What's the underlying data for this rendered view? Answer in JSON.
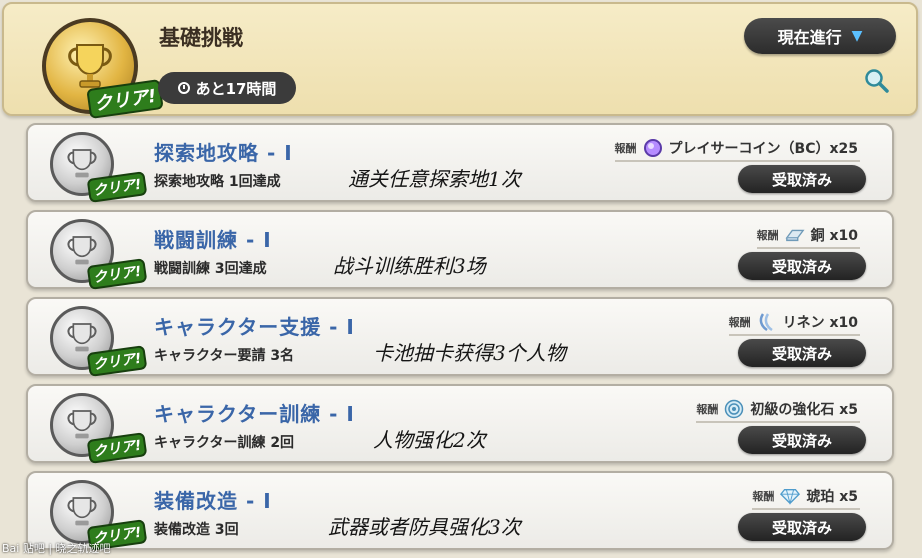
{
  "header": {
    "title": "基礎挑戦",
    "timer": "あと17時間",
    "progress_button": "現在進行",
    "clear_label": "クリア!"
  },
  "reward_label": "報酬",
  "claim_label": "受取済み",
  "missions": [
    {
      "name": "探索地攻略 - Ⅰ",
      "condition": "探索地攻略 1回達成",
      "note": "通关任意探索地1次",
      "reward": "プレイサーコイン（BC）x25",
      "reward_icon": "coin-icon",
      "reward_color": "#9b6bff"
    },
    {
      "name": "戦闘訓練 - Ⅰ",
      "condition": "戦闘訓練 3回達成",
      "note": "战斗训练胜利3场",
      "reward": "銅 x10",
      "reward_icon": "ingot-icon",
      "reward_color": "#8ab8d8"
    },
    {
      "name": "キャラクター支援 - Ⅰ",
      "condition": "キャラクター要請 3名",
      "note": "卡池抽卡获得3个人物",
      "reward": "リネン x10",
      "reward_icon": "linen-icon",
      "reward_color": "#7aa7d8"
    },
    {
      "name": "キャラクター訓練 - Ⅰ",
      "condition": "キャラクター訓練 2回",
      "note": "人物强化2次",
      "reward": "初級の強化石 x5",
      "reward_icon": "stone-icon",
      "reward_color": "#5aa0c8"
    },
    {
      "name": "装備改造 - Ⅰ",
      "condition": "装備改造 3回",
      "note": "武器或者防具强化3次",
      "reward": "琥珀 x5",
      "reward_icon": "gem-icon",
      "reward_color": "#6fb6e0"
    }
  ],
  "watermark": "Bai 贴吧 | 晓之轨迹吧"
}
